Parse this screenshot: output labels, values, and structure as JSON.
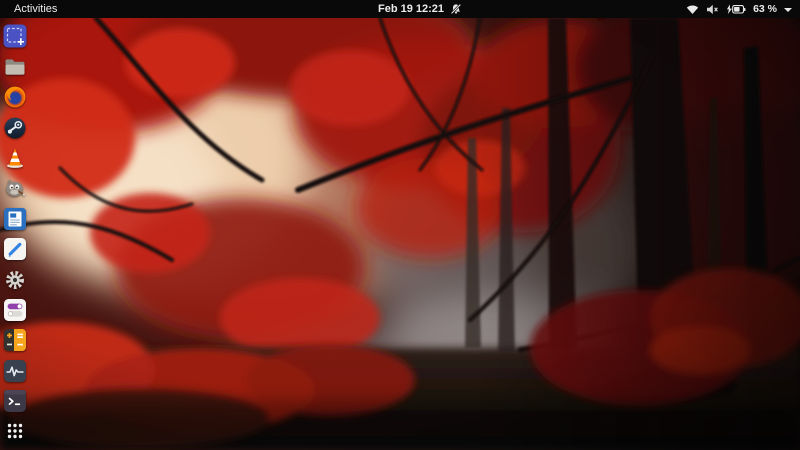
{
  "top_bar": {
    "activities_label": "Activities",
    "clock": "Feb 19 12:21",
    "do_not_disturb": true,
    "tray": {
      "battery_percent": "63 %",
      "icons": [
        "wifi-icon",
        "volume-muted-icon",
        "battery-charging-icon",
        "chevron-down-icon"
      ]
    }
  },
  "dock": {
    "items": [
      {
        "id": "flameshot",
        "icon": "flameshot-icon"
      },
      {
        "id": "files",
        "icon": "files-folder-icon"
      },
      {
        "id": "firefox",
        "icon": "firefox-icon"
      },
      {
        "id": "steam",
        "icon": "steam-icon"
      },
      {
        "id": "vlc",
        "icon": "vlc-cone-icon"
      },
      {
        "id": "gimp",
        "icon": "gimp-icon"
      },
      {
        "id": "libreoffice-writer",
        "icon": "libreoffice-writer-icon"
      },
      {
        "id": "text-editor",
        "icon": "text-editor-icon"
      },
      {
        "id": "settings",
        "icon": "settings-gear-icon"
      },
      {
        "id": "tweaks",
        "icon": "tweaks-icon"
      },
      {
        "id": "calculator",
        "icon": "calculator-icon"
      },
      {
        "id": "system-monitor",
        "icon": "system-monitor-icon"
      },
      {
        "id": "terminal",
        "icon": "terminal-icon"
      },
      {
        "id": "show-applications",
        "icon": "show-applications-grid-icon"
      }
    ]
  },
  "wallpaper": {
    "description": "Foggy autumn forest: red foliage canopy with bright peach light on the left, dark misty tree trunks on the right, red ferns over dark ground at the bottom",
    "colors": {
      "sky_glow": "#f0d2b0",
      "red_bright": "#d42a16",
      "red_mid": "#9c1710",
      "red_dark": "#4a100b",
      "fog_gray": "#756a6a",
      "trunk": "#140d0b",
      "ground": "#141010"
    }
  }
}
